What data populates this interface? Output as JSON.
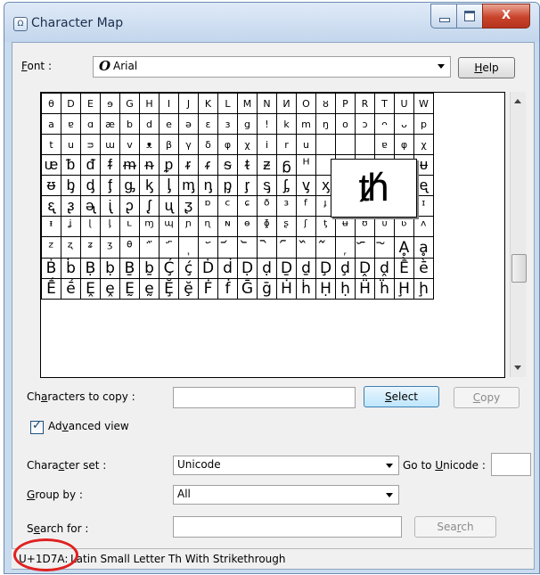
{
  "window": {
    "title": "Character Map",
    "close_glyph": "X"
  },
  "font": {
    "label": "Font :",
    "icon": "truetype-O-icon",
    "icon_glyph": "O",
    "value": "Arial"
  },
  "help_button": "Help",
  "grid": {
    "rows": [
      [
        "θ",
        "D",
        "E",
        "ɘ",
        "G",
        "H",
        "I",
        "J",
        "K",
        "L",
        "M",
        "N",
        "И",
        "O",
        "ȣ",
        "P",
        "R",
        "T",
        "U",
        "W"
      ],
      [
        "a",
        "ɐ",
        "ɑ",
        "æ",
        "b",
        "d",
        "e",
        "ə",
        "ɛ",
        "ɜ",
        "g",
        "!",
        "k",
        "m",
        "ŋ",
        "o",
        "ɔ",
        "ᴖ",
        "ᴗ",
        "p"
      ],
      [
        "t",
        "u",
        "ᴝ",
        "ɯ",
        "v",
        "ᴥ",
        "β",
        "γ",
        "δ",
        "φ",
        "χ",
        "i",
        "r",
        "u",
        "",
        "",
        "",
        "ɐ",
        "φ",
        "χ"
      ],
      [
        "ᵫ",
        "ᵬ",
        "ᵭ",
        "ᵮ",
        "ᵯ",
        "ᵰ",
        "ᵱ",
        "ᵲ",
        "ᵳ",
        "ᵴ",
        "ᵵ",
        "ᵶ",
        "ᵷ",
        "ᵸ",
        "",
        "",
        "",
        "ᵻ",
        "ᵽ",
        "ᵾ"
      ],
      [
        "ᵿ",
        "ᶀ",
        "ᶁ",
        "ᶂ",
        "ᶃ",
        "ᶄ",
        "ᶅ",
        "ᶆ",
        "ᶇ",
        "ᶈ",
        "ᶉ",
        "ᶊ",
        "ᶋ",
        "ᶌ",
        "ᶍ",
        "ᶎ",
        "ᶏ",
        "ᶐ",
        "ᶑ",
        "ᶒ"
      ],
      [
        "ᶓ",
        "ᶔ",
        "ᶕ",
        "ᶖ",
        "ᶗ",
        "ᶘ",
        "ᶙ",
        "ᶚ",
        "ᶛ",
        "ᶜ",
        "ᶝ",
        "ᶞ",
        "ᶟ",
        "ᶠ",
        "ᶡ",
        "ᶢ",
        "ᶣ",
        "ᶤ",
        "ᶥ",
        "ᶦ"
      ],
      [
        "ᶧ",
        "ᶨ",
        "ᶩ",
        "ᶪ",
        "ᶫ",
        "ᶬ",
        "ᶭ",
        "ᶮ",
        "ᶯ",
        "ᶰ",
        "ᶱ",
        "ᶲ",
        "ᶳ",
        "ᶴ",
        "ᶵ",
        "ᶶ",
        "ᶷ",
        "ᶸ",
        "ᶹ",
        "ᶺ"
      ],
      [
        "ᶻ",
        "ᶼ",
        "ᶽ",
        "ᶾ",
        "ᶿ",
        "᷀",
        "᷁",
        "᷂",
        "᷃",
        "᷄",
        "᷅",
        "᷆",
        "᷇",
        "᷈",
        "᷉",
        "᷊",
        "᷋",
        "᷌",
        "Ḁ",
        "ḁ"
      ],
      [
        "Ḃ",
        "ḃ",
        "Ḅ",
        "ḅ",
        "Ḇ",
        "ḇ",
        "Ḉ",
        "ḉ",
        "Ḋ",
        "ḋ",
        "Ḍ",
        "ḍ",
        "Ḏ",
        "ḏ",
        "Ḑ",
        "ḑ",
        "Ḓ",
        "ḓ",
        "Ḕ",
        "ḕ"
      ],
      [
        "Ḗ",
        "ḗ",
        "Ḙ",
        "ḙ",
        "Ḛ",
        "ḛ",
        "Ḝ",
        "ḝ",
        "Ḟ",
        "ḟ",
        "Ḡ",
        "ḡ",
        "Ḣ",
        "ḣ",
        "Ḥ",
        "ḥ",
        "Ḧ",
        "ḧ",
        "Ḩ",
        "ḩ"
      ]
    ],
    "zoomed_char": "ᵺ"
  },
  "characters_to_copy": {
    "label": "Characters to copy :",
    "value": ""
  },
  "select_button": "Select",
  "copy_button": "Copy",
  "advanced_view": {
    "label": "Advanced view",
    "checked": true
  },
  "character_set": {
    "label": "Character set :",
    "value": "Unicode"
  },
  "goto_unicode": {
    "label": "Go to Unicode :",
    "value": ""
  },
  "group_by": {
    "label": "Group by :",
    "value": "All"
  },
  "search_for": {
    "label": "Search for :",
    "value": ""
  },
  "search_button": "Search",
  "status": {
    "code": "U+1D7A:",
    "description": "Latin Small Letter Th With Strikethrough"
  }
}
